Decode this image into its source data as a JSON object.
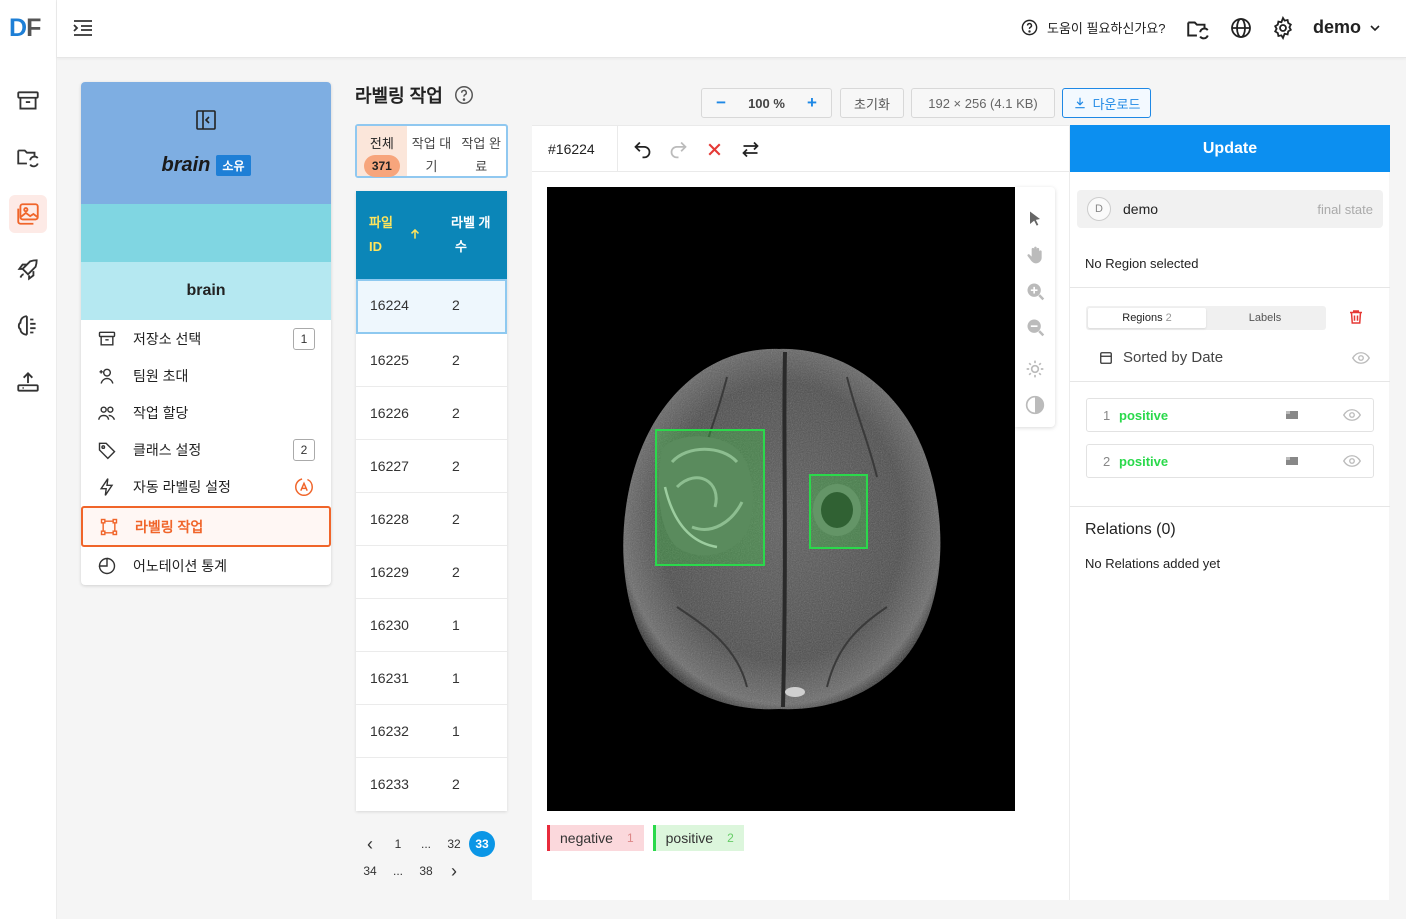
{
  "app": {
    "logo_d": "D",
    "logo_f": "F"
  },
  "topbar": {
    "help_text": "도움이 필요하신가요?",
    "user": "demo"
  },
  "project": {
    "header_title": "brain",
    "header_badge": "소유",
    "name": "brain",
    "nav": [
      {
        "label": "저장소 선택",
        "count": "1"
      },
      {
        "label": "팀원 초대"
      },
      {
        "label": "작업 할당"
      },
      {
        "label": "클래스 설정",
        "count": "2"
      },
      {
        "label": "자동 라벨링 설정"
      },
      {
        "label": "라벨링 작업"
      },
      {
        "label": "어노테이션 통계"
      }
    ]
  },
  "list": {
    "title": "라벨링 작업",
    "tabs": [
      {
        "line1": "전체",
        "line2": "371"
      },
      {
        "line1": "작업 대",
        "line2": "기"
      },
      {
        "line1": "작업 완",
        "line2": "료"
      }
    ],
    "col_id_1": "파일",
    "col_id_2": "ID",
    "col_count_1": "라벨 개",
    "col_count_2": "수",
    "rows": [
      {
        "id": "16224",
        "count": "2"
      },
      {
        "id": "16225",
        "count": "2"
      },
      {
        "id": "16226",
        "count": "2"
      },
      {
        "id": "16227",
        "count": "2"
      },
      {
        "id": "16228",
        "count": "2"
      },
      {
        "id": "16229",
        "count": "2"
      },
      {
        "id": "16230",
        "count": "1"
      },
      {
        "id": "16231",
        "count": "1"
      },
      {
        "id": "16232",
        "count": "1"
      },
      {
        "id": "16233",
        "count": "2"
      }
    ],
    "pager": {
      "prev": "‹",
      "p1": "1",
      "dots1": "...",
      "p32": "32",
      "p33": "33",
      "p34": "34",
      "dots2": "...",
      "p38": "38",
      "next": "›"
    }
  },
  "toolbar": {
    "zoom_minus": "−",
    "zoom_level": "100 %",
    "zoom_plus": "+",
    "reset": "초기화",
    "size": "192 × 256 (4.1 KB)",
    "download": "다운로드"
  },
  "editor": {
    "task_id": "#16224",
    "legend": [
      {
        "label": "negative",
        "count": "1",
        "color": "#e82b3c"
      },
      {
        "label": "positive",
        "count": "2",
        "color": "#2ad94b"
      }
    ]
  },
  "side": {
    "update": "Update",
    "annotator_initial": "D",
    "annotator": "demo",
    "state": "final state",
    "no_region": "No Region selected",
    "tab_regions": "Regions",
    "tab_regions_count": "2",
    "tab_labels": "Labels",
    "sorted": "Sorted by Date",
    "regions": [
      {
        "num": "1",
        "label": "positive"
      },
      {
        "num": "2",
        "label": "positive"
      }
    ],
    "relations_title": "Relations (0)",
    "relations_empty": "No Relations added yet"
  },
  "colors": {
    "accent": "#f0652a",
    "primary": "#0c8ff0",
    "positive": "#2ad94b",
    "negative": "#e82b3c"
  }
}
